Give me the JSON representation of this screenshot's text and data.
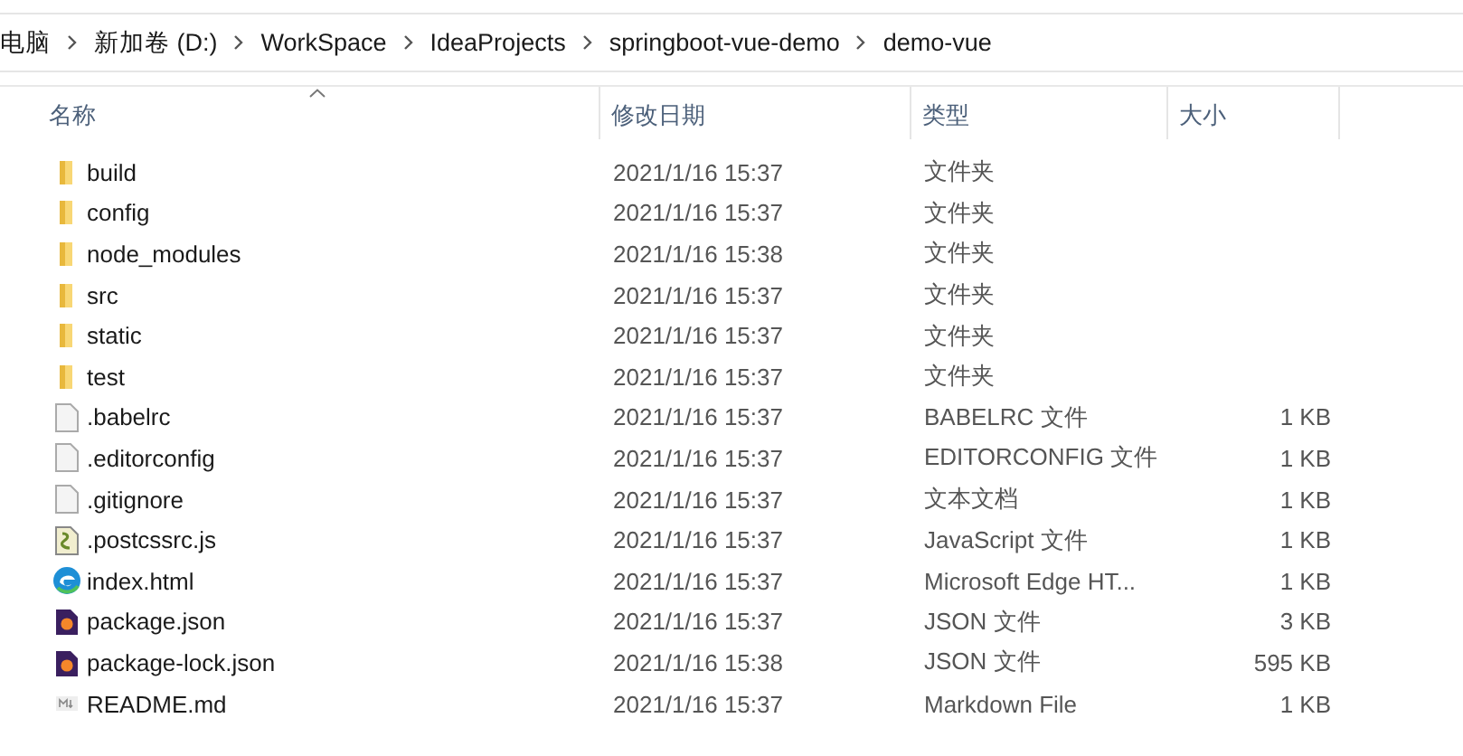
{
  "breadcrumb": [
    "电脑",
    "新加卷 (D:)",
    "WorkSpace",
    "IdeaProjects",
    "springboot-vue-demo",
    "demo-vue"
  ],
  "table": {
    "columns": [
      "名称",
      "修改日期",
      "类型",
      "大小"
    ],
    "rows": [
      {
        "kind": "folder",
        "name": "build",
        "date": "2021/1/16 15:37",
        "type": "文件夹"
      },
      {
        "kind": "folder",
        "name": "config",
        "date": "2021/1/16 15:37",
        "type": "文件夹"
      },
      {
        "kind": "folder",
        "name": "node_modules",
        "date": "2021/1/16 15:38",
        "type": "文件夹"
      },
      {
        "kind": "folder",
        "name": "src",
        "date": "2021/1/16 15:37",
        "type": "文件夹"
      },
      {
        "kind": "folder",
        "name": "static",
        "date": "2021/1/16 15:37",
        "type": "文件夹"
      },
      {
        "kind": "folder",
        "name": "test",
        "date": "2021/1/16 15:37",
        "type": "文件夹"
      },
      {
        "kind": "file",
        "name": ".babelrc",
        "date": "2021/1/16 15:37",
        "type": "BABELRC 文件",
        "size": "1 KB"
      },
      {
        "kind": "file",
        "name": ".editorconfig",
        "date": "2021/1/16 15:37",
        "type": "EDITORCONFIG 文件",
        "size": "1 KB"
      },
      {
        "kind": "file",
        "name": ".gitignore",
        "date": "2021/1/16 15:37",
        "type": "文本文档",
        "size": "1 KB"
      },
      {
        "kind": "script",
        "name": ".postcssrc.js",
        "date": "2021/1/16 15:37",
        "type": "JavaScript 文件",
        "size": "1 KB"
      },
      {
        "kind": "browser",
        "name": "index.html",
        "date": "2021/1/16 15:37",
        "type": "Microsoft Edge HT...",
        "size": "1 KB"
      },
      {
        "kind": "json",
        "name": "package.json",
        "date": "2021/1/16 15:37",
        "type": "JSON 文件",
        "size": "3 KB"
      },
      {
        "kind": "json",
        "name": "package-lock.json",
        "date": "2021/1/16 15:38",
        "type": "JSON 文件",
        "size": "595 KB"
      },
      {
        "kind": "markdown",
        "name": "README.md",
        "date": "2021/1/16 15:37",
        "type": "Markdown File",
        "size": "1 KB"
      }
    ]
  }
}
